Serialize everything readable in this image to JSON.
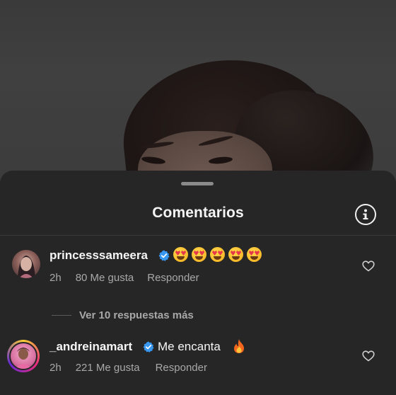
{
  "sheet": {
    "title": "Comentarios",
    "info_icon": "info-circle-icon"
  },
  "comments": [
    {
      "username": "princesssameera",
      "verified": true,
      "text_emoji_count": 5,
      "emoji": "heart-eyes",
      "age": "2h",
      "likes": "80 Me gusta",
      "reply": "Responder"
    },
    {
      "username": "_andreinamart",
      "verified": true,
      "text": "Me encanta",
      "emoji": "fire",
      "age": "2h",
      "likes": "221 Me gusta",
      "reply": "Responder"
    }
  ],
  "replies": {
    "more_label": "Ver 10 respuestas más"
  },
  "colors": {
    "sheet_bg": "#262626",
    "verified_blue": "#3897f0",
    "muted_text": "#a8a8a8"
  }
}
